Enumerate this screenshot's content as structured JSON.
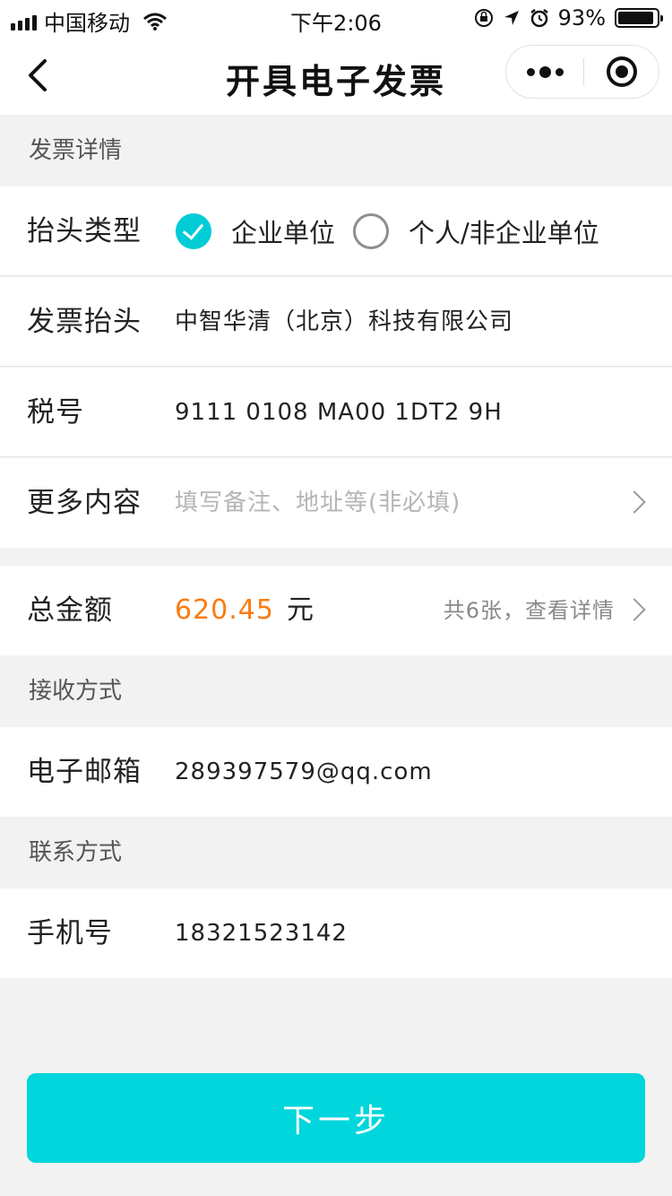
{
  "status_bar": {
    "carrier": "中国移动",
    "time": "下午2:06",
    "battery_text": "93%",
    "battery_level": 0.93
  },
  "nav": {
    "title": "开具电子发票"
  },
  "invoice_details": {
    "header": "发票详情",
    "title_type": {
      "label": "抬头类型",
      "options": [
        {
          "label": "企业单位",
          "checked": true
        },
        {
          "label": "个人/非企业单位",
          "checked": false
        }
      ]
    },
    "invoice_title": {
      "label": "发票抬头",
      "value": "中智华清（北京）科技有限公司"
    },
    "tax_number": {
      "label": "税号",
      "value": "9111 0108 MA00 1DT2 9H"
    },
    "more_content": {
      "label": "更多内容",
      "placeholder": "填写备注、地址等(非必填)"
    }
  },
  "total": {
    "label": "总金额",
    "amount": "620.45",
    "unit": "元",
    "detail_link": "共6张，查看详情"
  },
  "receive": {
    "header": "接收方式",
    "email_label": "电子邮箱",
    "email_value": "289397579@qq.com"
  },
  "contact": {
    "header": "联系方式",
    "phone_label": "手机号",
    "phone_value": "18321523142"
  },
  "next_button": "下一步",
  "colors": {
    "accent": "#00d6dc",
    "amount": "#fb7b12",
    "background": "#f2f2f2"
  }
}
